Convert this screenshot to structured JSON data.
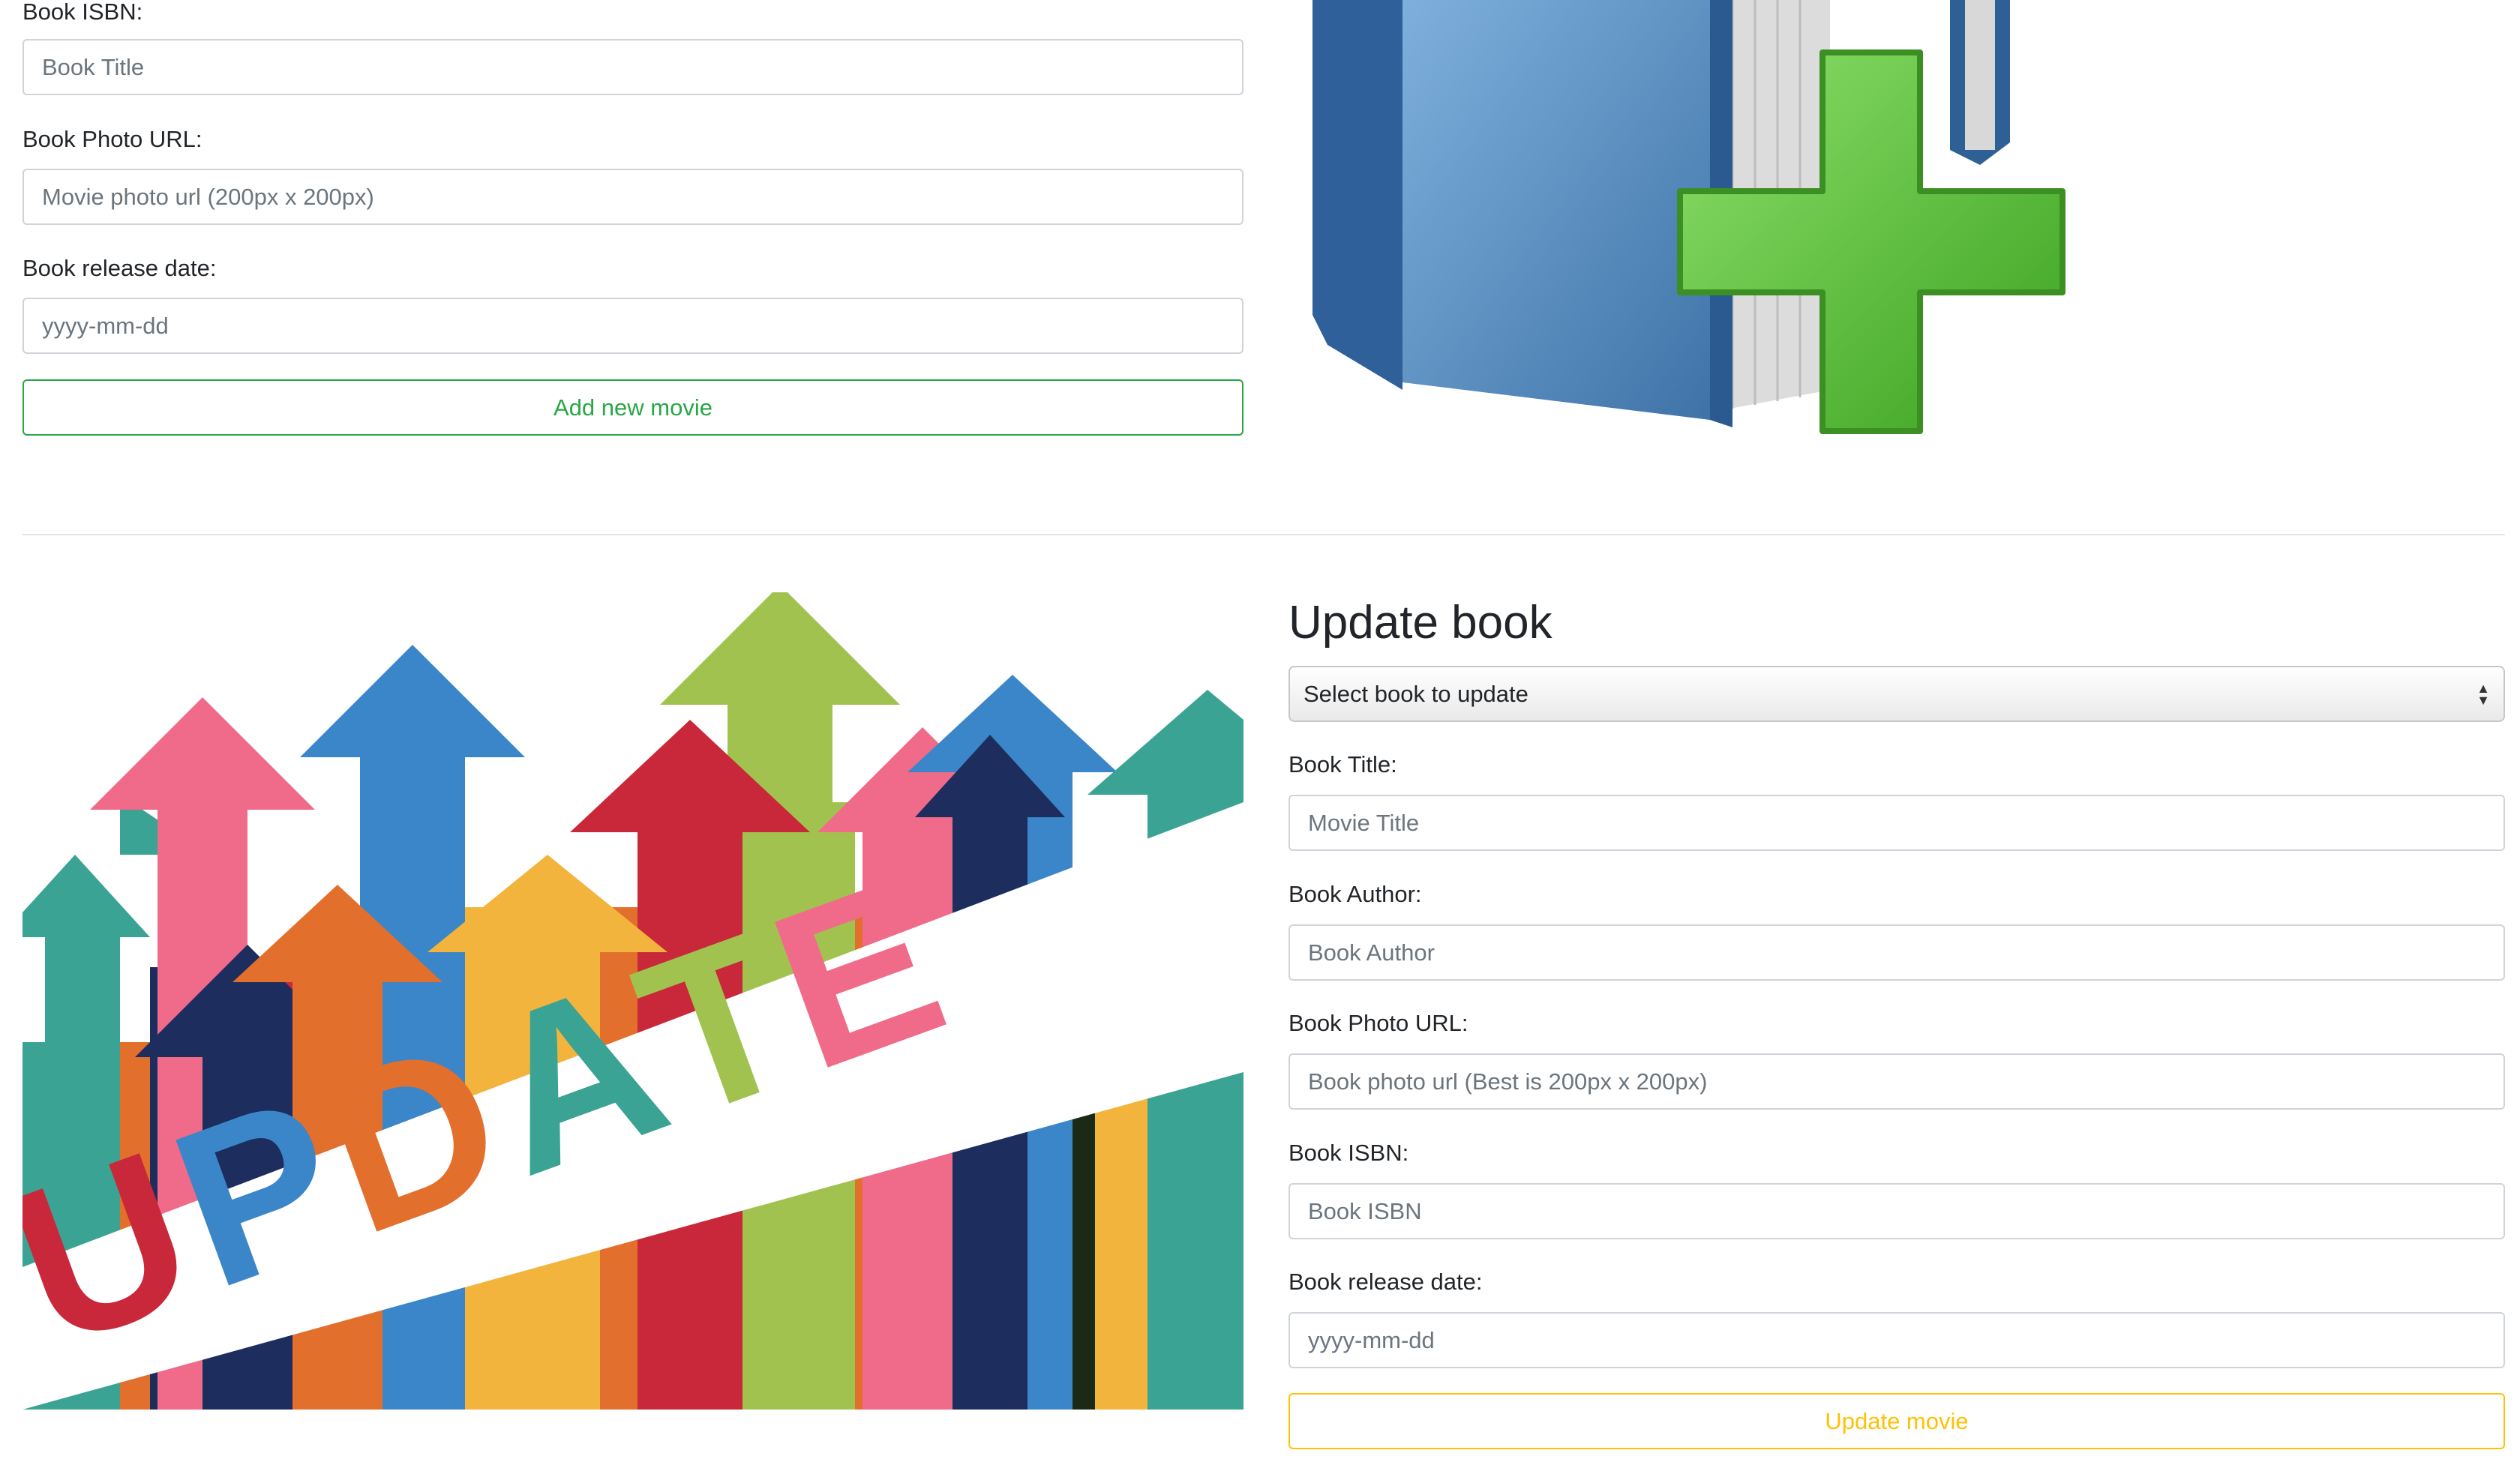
{
  "add_form": {
    "isbn_label": "Book ISBN:",
    "title_placeholder": "Book Title",
    "photo_label": "Book Photo URL:",
    "photo_placeholder": "Movie photo url (200px x 200px)",
    "date_label": "Book release date:",
    "date_placeholder": "yyyy-mm-dd",
    "submit_label": "Add new movie",
    "submit_color": "#28a745"
  },
  "add_image": {
    "icon": "book-add-icon",
    "book_color": "#4a80b8",
    "plus_color": "#4fbf2e"
  },
  "update_image": {
    "text": "UPDATE",
    "arrow_colors": [
      "#f06b8a",
      "#3a86c8",
      "#a2c250",
      "#c9283a",
      "#e36f2c",
      "#f2b43c",
      "#3aa394",
      "#1c2d5e"
    ]
  },
  "update_form": {
    "heading": "Update book",
    "select_value": "Select book to update",
    "title_label": "Book Title:",
    "title_placeholder": "Movie Title",
    "author_label": "Book Author:",
    "author_placeholder": "Book Author",
    "photo_label": "Book Photo URL:",
    "photo_placeholder": "Book photo url (Best is 200px x 200px)",
    "isbn_label": "Book ISBN:",
    "isbn_placeholder": "Book ISBN",
    "date_label": "Book release date:",
    "date_placeholder": "yyyy-mm-dd",
    "submit_label": "Update movie",
    "submit_color": "#ffc107"
  }
}
